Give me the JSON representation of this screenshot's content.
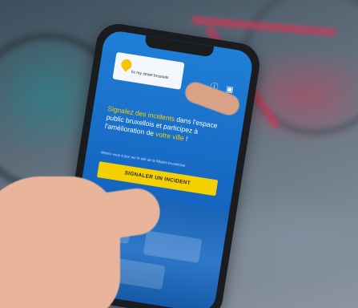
{
  "app": {
    "logo_text": "fix my street brussels",
    "headline_parts": [
      "Signalez des incidents",
      " dans l'espace public bruxellois et participez à l'amélioration de ",
      "votre ville",
      " !"
    ],
    "subtext": "Mettez-vous à jour sur le site de la Région bruxelloise",
    "cta_label": "SIGNALER UN INCIDENT",
    "icons": [
      "info-icon",
      "briefcase-icon"
    ]
  },
  "colors": {
    "app_blue": "#1565c0",
    "accent_yellow": "#f5d000"
  }
}
